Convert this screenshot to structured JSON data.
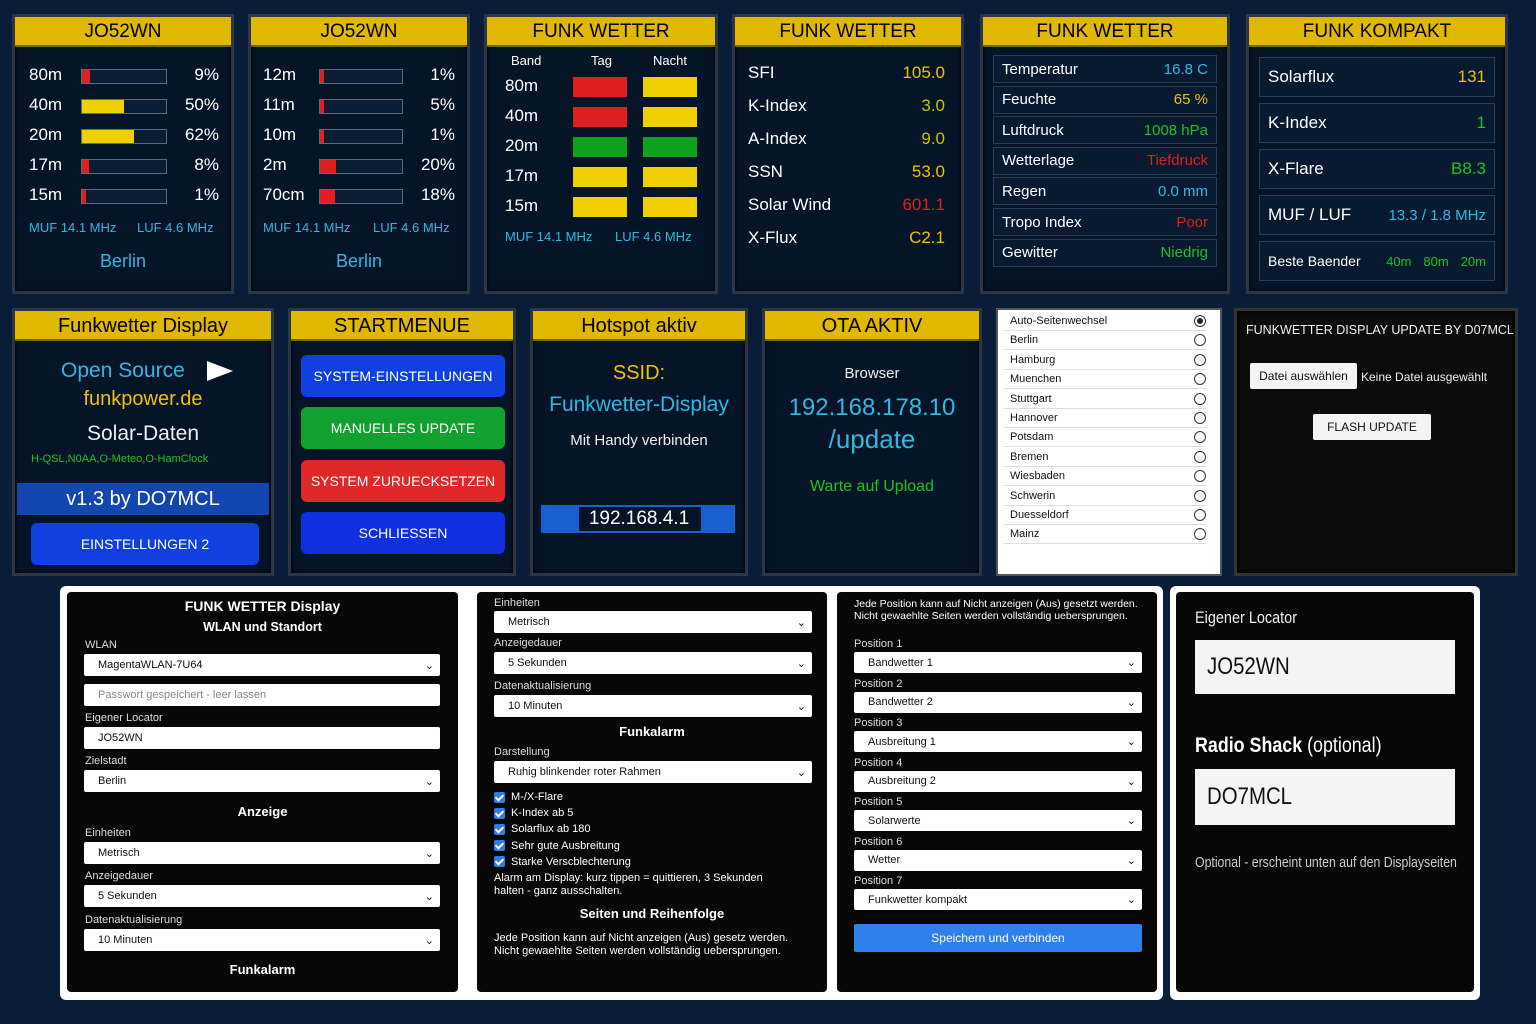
{
  "p1": {
    "title": "JO52WN",
    "bands": [
      {
        "label": "80m",
        "pct": "9%",
        "v": 0.09,
        "color": "#e02020"
      },
      {
        "label": "40m",
        "pct": "50%",
        "v": 0.5,
        "color": "#f0d000"
      },
      {
        "label": "20m",
        "pct": "62%",
        "v": 0.62,
        "color": "#f0d000"
      },
      {
        "label": "17m",
        "pct": "8%",
        "v": 0.08,
        "color": "#e02020"
      },
      {
        "label": "15m",
        "pct": "1%",
        "v": 0.01,
        "color": "#e02020"
      }
    ],
    "muf": "MUF 14.1 MHz",
    "luf": "LUF 4.6 MHz",
    "city": "Berlin"
  },
  "p2": {
    "title": "JO52WN",
    "bands": [
      {
        "label": "12m",
        "pct": "1%",
        "v": 0.01,
        "color": "#e02020"
      },
      {
        "label": "11m",
        "pct": "5%",
        "v": 0.05,
        "color": "#e02020"
      },
      {
        "label": "10m",
        "pct": "1%",
        "v": 0.01,
        "color": "#e02020"
      },
      {
        "label": "2m",
        "pct": "20%",
        "v": 0.2,
        "color": "#e02020"
      },
      {
        "label": "70cm",
        "pct": "18%",
        "v": 0.18,
        "color": "#e02020"
      }
    ],
    "muf": "MUF 14.1 MHz",
    "luf": "LUF 4.6 MHz",
    "city": "Berlin"
  },
  "p3": {
    "title": "FUNK WETTER",
    "col_band": "Band",
    "col_day": "Tag",
    "col_night": "Nacht",
    "rows": [
      {
        "band": "80m",
        "day": "#e02020",
        "night": "#f0d000"
      },
      {
        "band": "40m",
        "day": "#e02020",
        "night": "#f0d000"
      },
      {
        "band": "20m",
        "day": "#10a020",
        "night": "#10a020"
      },
      {
        "band": "17m",
        "day": "#f0d000",
        "night": "#f0d000"
      },
      {
        "band": "15m",
        "day": "#f0d000",
        "night": "#f0d000"
      }
    ],
    "muf": "MUF 14.1 MHz",
    "luf": "LUF 4.6 MHz"
  },
  "p4": {
    "title": "FUNK WETTER",
    "rows": [
      {
        "k": "SFI",
        "v": "105.0",
        "c": "#f0c000"
      },
      {
        "k": "K-Index",
        "v": "3.0",
        "c": "#c8c000"
      },
      {
        "k": "A-Index",
        "v": "9.0",
        "c": "#c8c000"
      },
      {
        "k": "SSN",
        "v": "53.0",
        "c": "#f0c000"
      },
      {
        "k": "Solar Wind",
        "v": "601.1",
        "c": "#e02020"
      },
      {
        "k": "X-Flux",
        "v": "C2.1",
        "c": "#f0c000"
      }
    ]
  },
  "p5": {
    "title": "FUNK WETTER",
    "rows": [
      {
        "k": "Temperatur",
        "v": "16.8 C",
        "c": "#2fb8e0"
      },
      {
        "k": "Feuchte",
        "v": "65 %",
        "c": "#f0c000"
      },
      {
        "k": "Luftdruck",
        "v": "1008 hPa",
        "c": "#20c020"
      },
      {
        "k": "Wetterlage",
        "v": "Tiefdruck",
        "c": "#e02020"
      },
      {
        "k": "Regen",
        "v": "0.0 mm",
        "c": "#2fb8e0"
      },
      {
        "k": "Tropo Index",
        "v": "Poor",
        "c": "#e02020"
      },
      {
        "k": "Gewitter",
        "v": "Niedrig",
        "c": "#20c020"
      }
    ]
  },
  "p6": {
    "title": "FUNK KOMPAKT",
    "rows": [
      {
        "k": "Solarflux",
        "v": "131",
        "c": "#f0c000"
      },
      {
        "k": "K-Index",
        "v": "1",
        "c": "#20c020"
      },
      {
        "k": "X-Flare",
        "v": "B8.3",
        "c": "#20c020"
      },
      {
        "k": "MUF / LUF",
        "v": "13.3 / 1.8 MHz",
        "c": "#2fb8e0"
      }
    ],
    "best_label": "Beste Baender",
    "best": [
      "40m",
      "80m",
      "20m"
    ]
  },
  "p7": {
    "title": "Funkwetter Display",
    "open": "Open Source",
    "site": "funkpower.de",
    "solar": "Solar-Daten",
    "sources": "H-QSL,N0AA,O-Meteo,O-HamClock",
    "version": "v1.3 by DO7MCL",
    "btn": "EINSTELLUNGEN 2"
  },
  "p8": {
    "title": "STARTMENUE",
    "b1": "SYSTEM-EINSTELLUNGEN",
    "b2": "MANUELLES UPDATE",
    "b3": "SYSTEM ZURUECKSETZEN",
    "b4": "SCHLIESSEN"
  },
  "p9": {
    "title": "Hotspot aktiv",
    "ssid_label": "SSID:",
    "ssid": "Funkwetter-Display",
    "hint": "Mit Handy verbinden",
    "ip": "192.168.4.1"
  },
  "p10": {
    "title": "OTA AKTIV",
    "browser": "Browser",
    "ip": "192.168.178.10",
    "path": "/update",
    "wait": "Warte auf Upload"
  },
  "p11": {
    "items": [
      {
        "name": "Auto-Seitenwechsel",
        "on": true
      },
      {
        "name": "Berlin",
        "on": false
      },
      {
        "name": "Hamburg",
        "on": false
      },
      {
        "name": "Muenchen",
        "on": false
      },
      {
        "name": "Stuttgart",
        "on": false
      },
      {
        "name": "Hannover",
        "on": false
      },
      {
        "name": "Potsdam",
        "on": false
      },
      {
        "name": "Bremen",
        "on": false
      },
      {
        "name": "Wiesbaden",
        "on": false
      },
      {
        "name": "Schwerin",
        "on": false
      },
      {
        "name": "Duesseldorf",
        "on": false
      },
      {
        "name": "Mainz",
        "on": false
      }
    ]
  },
  "p12": {
    "title": "FUNKWETTER DISPLAY UPDATE BY D07MCL",
    "choose": "Datei auswählen",
    "nofile": "Keine Datei ausgewählt",
    "flash": "FLASH UPDATE"
  },
  "f1": {
    "title": "FUNK WETTER Display",
    "subtitle": "WLAN und Standort",
    "wlan_label": "WLAN",
    "wlan": "MagentaWLAN-7U64",
    "pw_placeholder": "Passwort gespeichert - leer lassen",
    "loc_label": "Eigener Locator",
    "loc": "JO52WN",
    "city_label": "Zielstadt",
    "city": "Berlin",
    "anzeige": "Anzeige",
    "units_label": "Einheiten",
    "units": "Metrisch",
    "dur_label": "Anzeigedauer",
    "dur": "5 Sekunden",
    "upd_label": "Datenaktualisierung",
    "upd": "10 Minuten",
    "alarm": "Funkalarm"
  },
  "f2": {
    "units_label": "Einheiten",
    "units": "Metrisch",
    "dur_label": "Anzeigedauer",
    "dur": "5 Sekunden",
    "upd_label": "Datenaktualisierung",
    "upd": "10 Minuten",
    "alarm": "Funkalarm",
    "disp_label": "Darstellung",
    "disp": "Ruhig blinkender roter Rahmen",
    "checks": [
      "M-/X-Flare",
      "K-Index ab 5",
      "Solarflux ab 180",
      "Sehr gute Ausbreitung",
      "Starke Verscblechterung"
    ],
    "alarm_note": "Alarm am Display: kurz tippen = quittieren, 3 Sekunden halten - ganz ausschalten.",
    "pages": "Seiten und Reihenfolge",
    "pages_note": "Jede Position kann auf Nicht anzeigen (Aus) gesetz werden. Nicht gewaehlte Seiten werden vollständig uebersprungen."
  },
  "f3": {
    "note": "Jede Position kann auf Nicht anzeigen (Aus) gesetzt werden. Nicht gewaehlte Seiten werden vollständig uebersprungen.",
    "positions": [
      {
        "label": "Position 1",
        "value": "Bandwetter 1"
      },
      {
        "label": "Position 2",
        "value": "Bandwetter 2"
      },
      {
        "label": "Position 3",
        "value": "Ausbreitung 1"
      },
      {
        "label": "Position 4",
        "value": "Ausbreitung 2"
      },
      {
        "label": "Position 5",
        "value": "Solarwerte"
      },
      {
        "label": "Position 6",
        "value": "Wetter"
      },
      {
        "label": "Position 7",
        "value": "Funkwetter kompakt"
      }
    ],
    "save": "Speichern und verbinden"
  },
  "f4": {
    "loc_label": "Eigener Locator",
    "loc": "JO52WN",
    "shack_label": "Radio Shack",
    "shack_opt": "(optional)",
    "shack": "DO7MCL",
    "note": "Optional - erscheint unten auf den Displayseiten"
  }
}
